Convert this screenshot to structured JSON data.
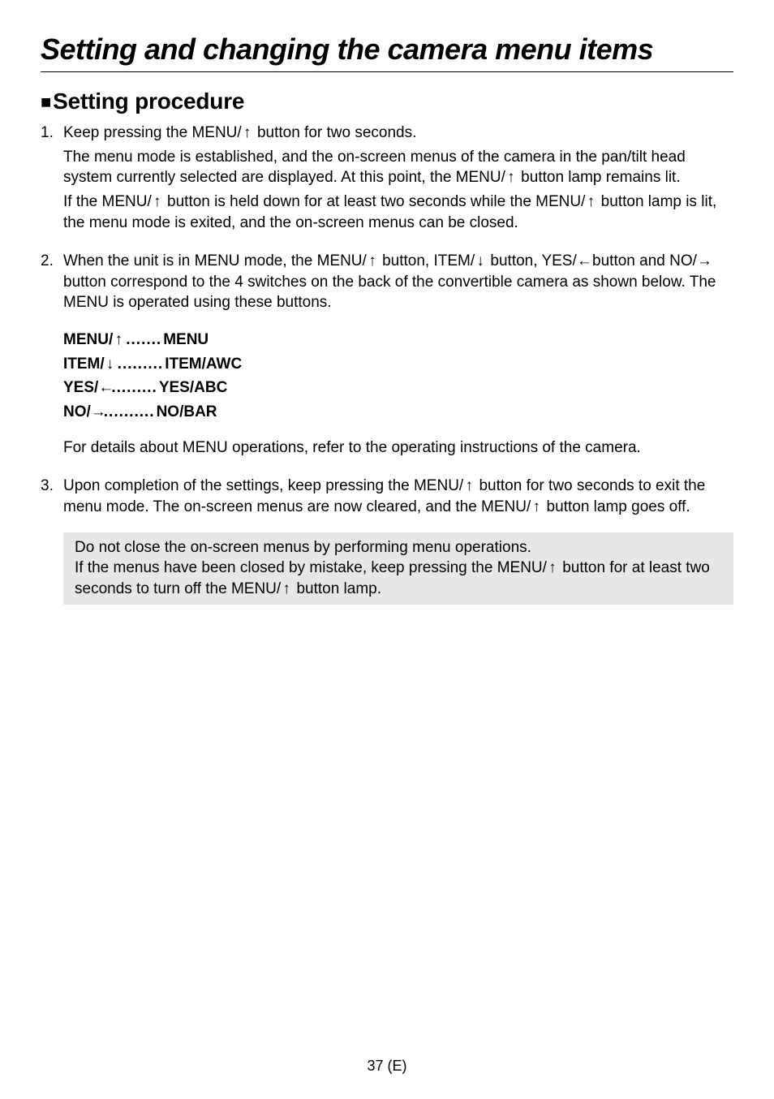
{
  "title": "Setting and changing the camera menu items",
  "subheading": "Setting procedure",
  "glyph": {
    "up": "↑",
    "down": "↓",
    "left": "←",
    "right": "→",
    "square": "■"
  },
  "steps": {
    "s1": {
      "p1a": "Keep pressing the MENU/",
      "p1b": " button for two seconds.",
      "p2a": "The menu mode is established, and the on-screen menus of the camera in the pan/tilt head system currently selected are displayed. At this point, the MENU/",
      "p2b": " button lamp remains lit.",
      "p3a": "If the MENU/",
      "p3b": " button is held down for at least two seconds while the MENU/",
      "p3c": " button lamp is lit, the menu mode is exited, and the on-screen menus can be closed."
    },
    "s2": {
      "p1a": "When the unit is in MENU mode, the MENU/",
      "p1b": " button, ITEM/",
      "p1c": " button, YES/",
      "p1d": " button and NO/",
      "p1e": " button correspond to the 4 switches on the back of the convertible camera as shown below. The MENU is operated using these buttons.",
      "map": {
        "r1k": "MENU/",
        "r1d": " .......",
        "r1v": "MENU",
        "r2k": "ITEM/",
        "r2d": " .........",
        "r2v": "ITEM/AWC",
        "r3k": "YES/",
        "r3d": " .........",
        "r3v": "YES/ABC",
        "r4k": "NO/",
        "r4d": " ..........",
        "r4v": "NO/BAR"
      },
      "ref": "For details about MENU operations, refer to the operating instructions of the camera."
    },
    "s3": {
      "p1a": "Upon completion of the settings, keep pressing the MENU/",
      "p1b": " button for two seconds to exit the menu mode. The on-screen menus are now cleared, and the MENU/",
      "p1c": " button lamp goes off.",
      "note1": "Do not close the on-screen menus by performing menu operations.",
      "note2a": "If the menus have been closed by mistake, keep pressing the MENU/",
      "note2b": " button for at least two seconds to turn off the MENU/",
      "note2c": " button lamp."
    }
  },
  "footer": "37 (E)"
}
